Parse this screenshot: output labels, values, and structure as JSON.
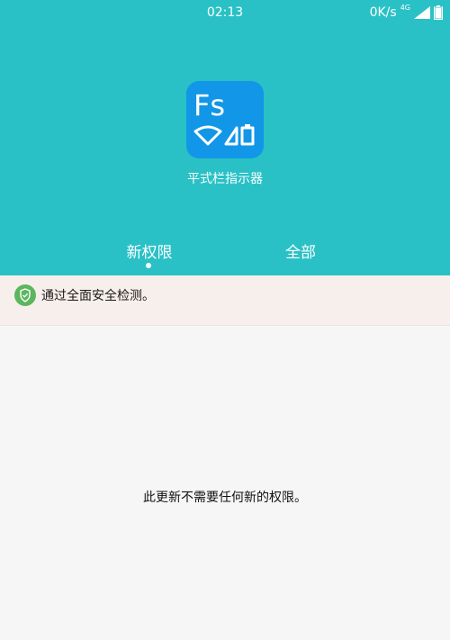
{
  "status_bar": {
    "time": "02:13",
    "network_speed": "0K/s",
    "network_type": "4G"
  },
  "app": {
    "name": "平式栏指示器",
    "icon_text": "Fs"
  },
  "tabs": [
    {
      "label": "新权限",
      "active": true
    },
    {
      "label": "全部",
      "active": false
    }
  ],
  "security": {
    "message": "通过全面安全检测。"
  },
  "content": {
    "message": "此更新不需要任何新的权限。"
  },
  "colors": {
    "header": "#29c1c6",
    "icon_bg": "#1296e8",
    "security_bg": "#f7efeb",
    "shield": "#5bb65e"
  }
}
